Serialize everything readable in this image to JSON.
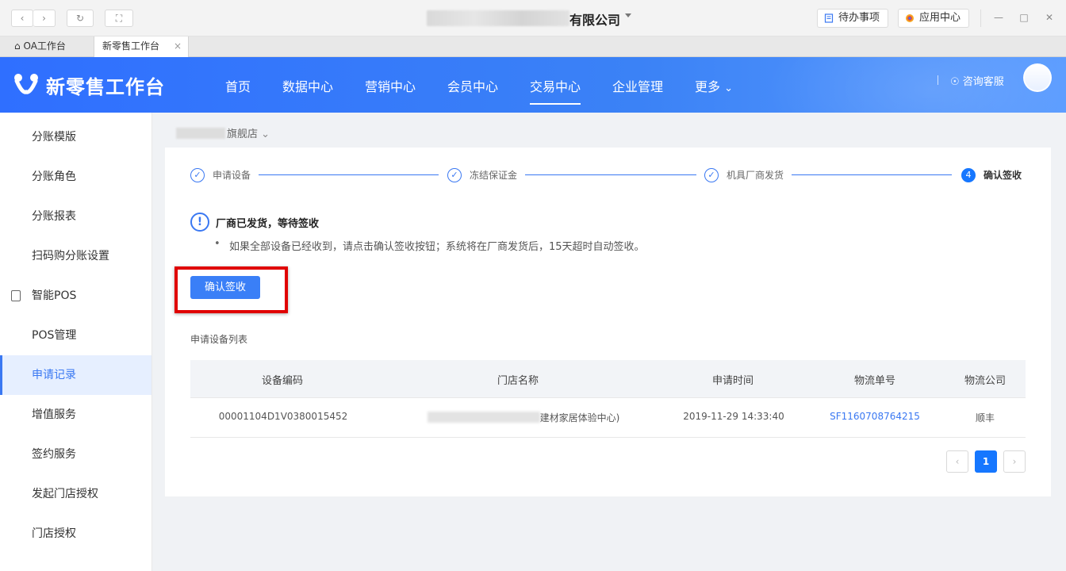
{
  "window": {
    "title_visible": "有限公司",
    "todo_label": "待办事项",
    "app_center_label": "应用中心",
    "todo_icon": "list-icon",
    "app_center_icon": "apps-icon"
  },
  "tabs": [
    {
      "label": "OA工作台",
      "icon": "home-icon"
    },
    {
      "label": "新零售工作台",
      "close": "×"
    }
  ],
  "header": {
    "logo_text": "新零售工作台",
    "nav": [
      "首页",
      "数据中心",
      "营销中心",
      "会员中心",
      "交易中心",
      "企业管理",
      "更多"
    ],
    "active_nav": "交易中心",
    "consult_label": "咨询客服",
    "brand_color": "#3a78f2"
  },
  "sidebar": {
    "items": [
      "分账模版",
      "分账角色",
      "分账报表",
      "扫码购分账设置",
      "智能POS",
      "POS管理",
      "申请记录",
      "增值服务",
      "签约服务",
      "发起门店授权",
      "门店授权"
    ],
    "active_item": "申请记录"
  },
  "breadcrumb": {
    "store_suffix": "旗舰店"
  },
  "steps": [
    {
      "label": "申请设备",
      "marker": "✓"
    },
    {
      "label": "冻结保证金",
      "marker": "✓"
    },
    {
      "label": "机具厂商发货",
      "marker": "✓"
    },
    {
      "label": "确认签收",
      "marker": "4"
    }
  ],
  "alert": {
    "title": "厂商已发货，等待签收",
    "description": "如果全部设备已经收到，请点击确认签收按钮；系统将在厂商发货后，15天超时自动签收。"
  },
  "confirm_button_label": "确认签收",
  "list_title": "申请设备列表",
  "table": {
    "columns": [
      "设备编码",
      "门店名称",
      "申请时间",
      "物流单号",
      "物流公司"
    ],
    "rows": [
      {
        "device_code": "00001104D1V0380015452",
        "store_name_suffix": "建材家居体验中心)",
        "apply_time": "2019-11-29 14:33:40",
        "tracking_no": "SF1160708764215",
        "carrier": "顺丰"
      }
    ]
  },
  "pagination": {
    "prev": "‹",
    "current": "1",
    "next": "›"
  }
}
